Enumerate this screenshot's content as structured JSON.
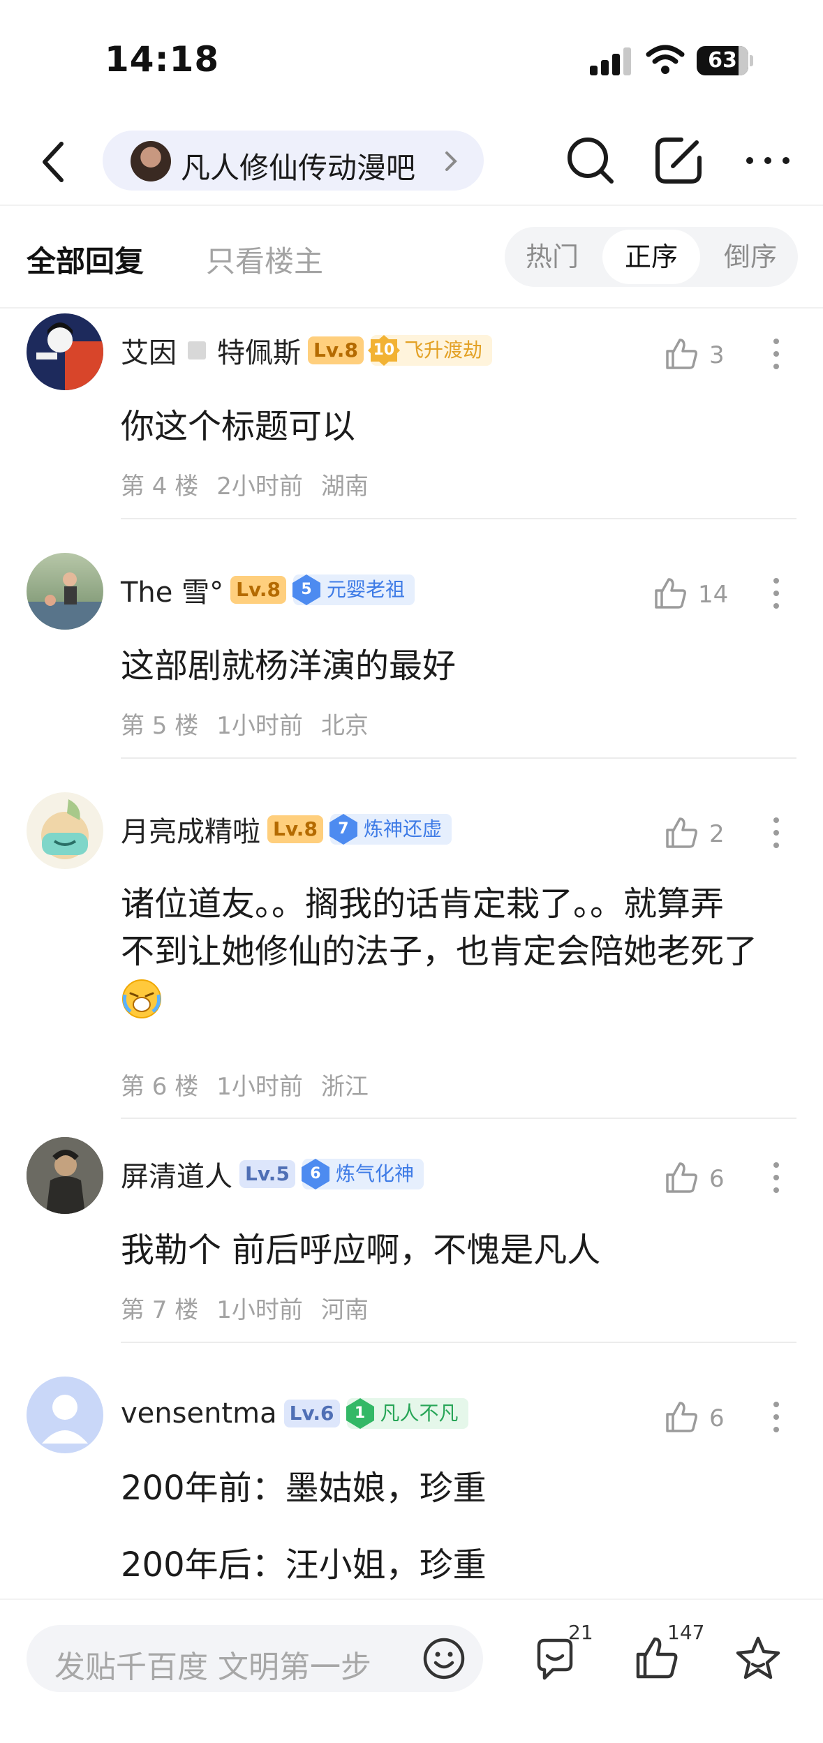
{
  "status": {
    "time": "14:18",
    "battery": "63"
  },
  "nav": {
    "forum_name": "凡人修仙传动漫吧"
  },
  "tabs": {
    "all": "全部回复",
    "host_only": "只看楼主",
    "sort": [
      "热门",
      "正序",
      "倒序"
    ],
    "sort_active": "正序"
  },
  "posts": [
    {
      "name_a": "艾因",
      "name_b": "特佩斯",
      "level": "Lv.8",
      "badge_num": "10",
      "badge_label": "飞升渡劫",
      "likes": "3",
      "text": "你这个标题可以",
      "floor": "第 4 楼",
      "time": "2小时前",
      "region": "湖南"
    },
    {
      "name": "The 雪°",
      "level": "Lv.8",
      "badge_num": "5",
      "badge_label": "元婴老祖",
      "likes": "14",
      "text": "这部剧就杨洋演的最好",
      "floor": "第 5 楼",
      "time": "1小时前",
      "region": "北京"
    },
    {
      "name": "月亮成精啦",
      "level": "Lv.8",
      "badge_num": "7",
      "badge_label": "炼神还虚",
      "likes": "2",
      "line1": "诸位道友。。搁我的话肯定栽了。。就算弄",
      "line2": "不到让她修仙的法子，也肯定会陪她老死了",
      "floor": "第 6 楼",
      "time": "1小时前",
      "region": "浙江"
    },
    {
      "name": "屏清道人",
      "level": "Lv.5",
      "badge_num": "6",
      "badge_label": "炼气化神",
      "likes": "6",
      "text": "我勒个 前后呼应啊，不愧是凡人",
      "floor": "第 7 楼",
      "time": "1小时前",
      "region": "河南"
    },
    {
      "name": "vensentma",
      "level": "Lv.6",
      "badge_num": "1",
      "badge_label": "凡人不凡",
      "likes": "6",
      "line1": "200年前：墨姑娘，珍重",
      "line2": "200年后：汪小姐，珍重"
    }
  ],
  "bottom": {
    "placeholder": "发贴千百度 文明第一步",
    "reply_count": "21",
    "like_count": "147"
  }
}
